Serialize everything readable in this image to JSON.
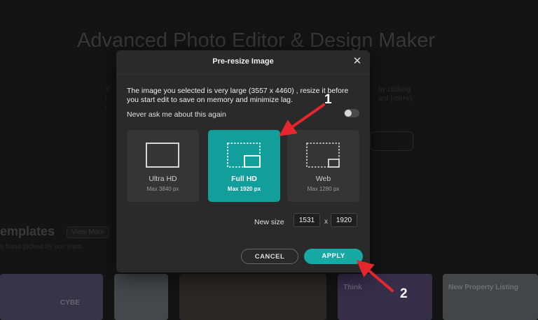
{
  "background": {
    "title": "Advanced Photo Editor & Design Maker",
    "templates_heading": "emplates",
    "view_more": "View More",
    "templates_sub": "s hand picked by our team.",
    "thumbnails": [
      "CYBE",
      "",
      "",
      "",
      "Think",
      "New Property Listing"
    ]
  },
  "dialog": {
    "title": "Pre-resize Image",
    "message": "The image you selected is very large (3557 x 4460) , resize it before you start edit to save on memory and minimize lag.",
    "never_ask_label": "Never ask me about this again",
    "never_ask_checked": false,
    "options": [
      {
        "name": "Ultra HD",
        "max": "Max 3840 px",
        "selected": false,
        "icon": "ultra-hd-frame-icon"
      },
      {
        "name": "Full HD",
        "max": "Max 1920 px",
        "selected": true,
        "icon": "full-hd-frame-icon"
      },
      {
        "name": "Web",
        "max": "Max 1280 px",
        "selected": false,
        "icon": "web-frame-icon"
      }
    ],
    "new_size_label": "New size",
    "width_value": "1531",
    "times": "x",
    "height_value": "1920",
    "cancel_label": "CANCEL",
    "apply_label": "APPLY"
  },
  "annotations": {
    "callout_1": "1",
    "callout_2": "2",
    "arrow_color": "#e5262c"
  },
  "colors": {
    "accent": "#17a9a4",
    "selected_option": "#129f9b",
    "dialog_bg": "#2a2a2b"
  }
}
